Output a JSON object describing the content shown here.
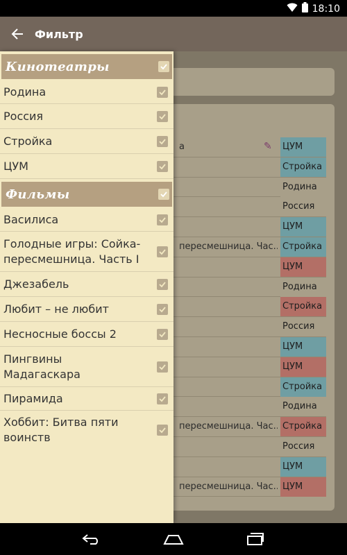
{
  "status_bar": {
    "time": "18:10",
    "icons": [
      "wifi-icon",
      "battery-icon"
    ]
  },
  "app_bar": {
    "title": "Фильтр",
    "back_icon": "arrow-left-icon"
  },
  "drawer": {
    "sections": [
      {
        "title": "Кинотеатры",
        "checked": true,
        "items": [
          {
            "label": "Родина",
            "checked": true
          },
          {
            "label": "Россия",
            "checked": true
          },
          {
            "label": "Стройка",
            "checked": true
          },
          {
            "label": "ЦУМ",
            "checked": true
          }
        ]
      },
      {
        "title": "Фильмы",
        "checked": true,
        "items": [
          {
            "label": "Василиса",
            "checked": true
          },
          {
            "label": "Голодные игры: Сойка-пересмешница. Часть I",
            "checked": true
          },
          {
            "label": "Джезабель",
            "checked": true
          },
          {
            "label": "Любит – не любит",
            "checked": true
          },
          {
            "label": "Несносные боссы 2",
            "checked": true
          },
          {
            "label": "Пингвины Мадагаскара",
            "checked": true
          },
          {
            "label": "Пирамида",
            "checked": true
          },
          {
            "label": "Хоббит: Битва пяти воинств",
            "checked": true
          }
        ]
      }
    ]
  },
  "background_schedule": {
    "rows": [
      {
        "title": "а",
        "cinema": "ЦУМ",
        "color": "#6f9ea3",
        "pen": true
      },
      {
        "title": "",
        "cinema": "Стройка",
        "color": "#6f9ea3"
      },
      {
        "title": "",
        "cinema": "Родина",
        "color": "#a89f89"
      },
      {
        "title": "",
        "cinema": "Россия",
        "color": "#a89f89"
      },
      {
        "title": "",
        "cinema": "ЦУМ",
        "color": "#6f9ea3"
      },
      {
        "title": "пересмешница. Час...",
        "cinema": "Стройка",
        "color": "#6f9ea3"
      },
      {
        "title": "",
        "cinema": "ЦУМ",
        "color": "#b36f66"
      },
      {
        "title": "",
        "cinema": "Родина",
        "color": "#a89f89"
      },
      {
        "title": "",
        "cinema": "Стройка",
        "color": "#b36f66"
      },
      {
        "title": "",
        "cinema": "Россия",
        "color": "#a89f89"
      },
      {
        "title": "",
        "cinema": "ЦУМ",
        "color": "#6f9ea3"
      },
      {
        "title": "",
        "cinema": "ЦУМ",
        "color": "#b36f66"
      },
      {
        "title": "",
        "cinema": "Стройка",
        "color": "#6f9ea3"
      },
      {
        "title": "",
        "cinema": "Родина",
        "color": "#a89f89"
      },
      {
        "title": "пересмешница. Час...",
        "cinema": "Стройка",
        "color": "#b36f66"
      },
      {
        "title": "",
        "cinema": "Россия",
        "color": "#a89f89"
      },
      {
        "title": "",
        "cinema": "ЦУМ",
        "color": "#6f9ea3"
      },
      {
        "title": "пересмешница. Час...",
        "cinema": "ЦУМ",
        "color": "#b36f66"
      }
    ]
  },
  "nav_bar": {
    "icons": [
      "back-nav-icon",
      "home-nav-icon",
      "recents-nav-icon"
    ]
  }
}
